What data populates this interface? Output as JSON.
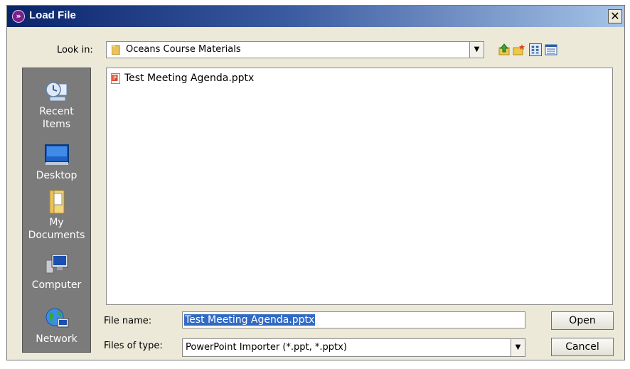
{
  "window": {
    "title": "Load File",
    "close_glyph": "✕"
  },
  "look_in": {
    "label": "Look in:",
    "value": "Oceans Course Materials"
  },
  "toolbar": {
    "icons": [
      "up-folder-icon",
      "new-folder-icon",
      "list-view-icon",
      "details-view-icon"
    ]
  },
  "places": [
    {
      "label_line1": "Recent",
      "label_line2": "Items",
      "icon": "recent-items-icon"
    },
    {
      "label_line1": "Desktop",
      "label_line2": "",
      "icon": "desktop-icon"
    },
    {
      "label_line1": "My",
      "label_line2": "Documents",
      "icon": "my-documents-icon"
    },
    {
      "label_line1": "Computer",
      "label_line2": "",
      "icon": "computer-icon"
    },
    {
      "label_line1": "Network",
      "label_line2": "",
      "icon": "network-icon"
    }
  ],
  "files": [
    {
      "name": "Test Meeting Agenda.pptx",
      "icon": "powerpoint-file-icon"
    }
  ],
  "file_name": {
    "label": "File name:",
    "value": "Test Meeting Agenda.pptx"
  },
  "file_type": {
    "label": "Files of type:",
    "value": "PowerPoint Importer (*.ppt, *.pptx)"
  },
  "buttons": {
    "open": "Open",
    "cancel": "Cancel"
  },
  "colors": {
    "title_start": "#0a246a",
    "title_end": "#a6c3e6",
    "places_bg": "#7b7b7b",
    "selection": "#316ac5",
    "dialog_bg": "#ece9d8"
  }
}
